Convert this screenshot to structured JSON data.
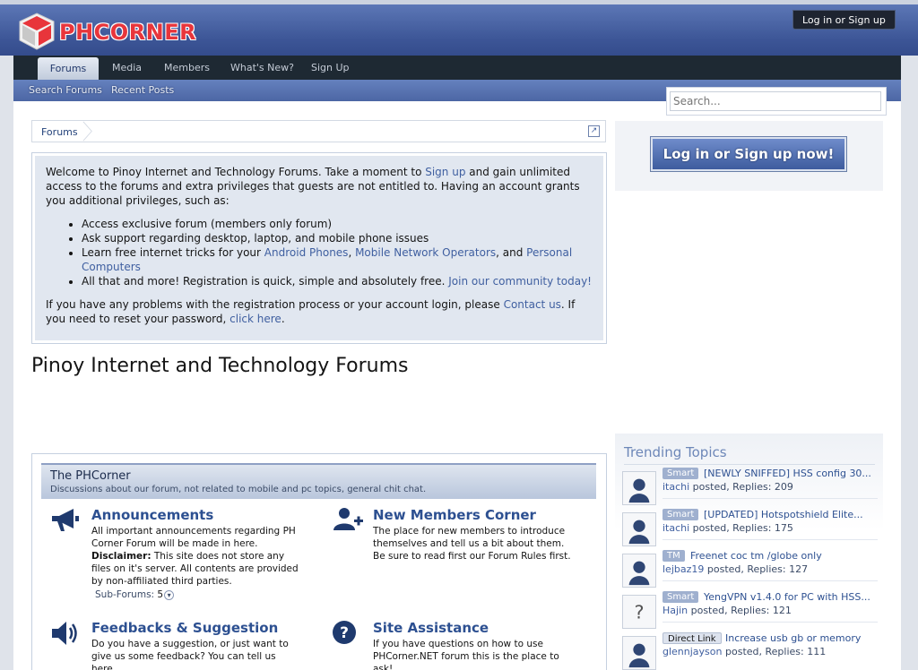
{
  "header": {
    "logo_text": "PHCORNER",
    "login_tab": "Log in or Sign up"
  },
  "nav": {
    "tabs": [
      {
        "label": "Forums"
      },
      {
        "label": "Media"
      },
      {
        "label": "Members"
      },
      {
        "label": "What's New?"
      },
      {
        "label": "Sign Up"
      }
    ],
    "subnav": [
      "Search Forums",
      "Recent Posts"
    ]
  },
  "search": {
    "placeholder": "Search..."
  },
  "breadcrumb": {
    "item": "Forums"
  },
  "notice": {
    "intro_1": "Welcome to Pinoy Internet and Technology Forums. Take a moment to ",
    "signup_link": "Sign up",
    "intro_2": " and gain unlimited access to the forums and extra privileges that guests are not entitled to. Having an account grants you additional privileges, such as:",
    "bullets": {
      "b1": "Access exclusive forum (members only forum)",
      "b2": "Ask support regarding desktop, laptop, and mobile phone issues",
      "b3_text": "Learn free internet tricks for your ",
      "b3_link1": "Android Phones",
      "b3_sep1": ", ",
      "b3_link2": "Mobile Network Operators",
      "b3_sep2": ", and ",
      "b3_link3": "Personal Computers",
      "b4_text": "All that and more! Registration is quick, simple and absolutely free. ",
      "b4_link": "Join our community today!"
    },
    "problem_1": "If you have any problems with the registration process or your account login, please ",
    "contact_link": "Contact us",
    "problem_2": ". If you need to reset your password, ",
    "reset_link": "click here",
    "problem_3": "."
  },
  "forum_title": "Pinoy Internet and Technology Forums",
  "category": {
    "title": "The PHCorner",
    "description": "Discussions about our forum, not related to mobile and pc topics, general chit chat."
  },
  "nodes": {
    "announcements": {
      "title": "Announcements",
      "desc": "All important announcements regarding PH Corner Forum will be made in here.",
      "disclaimer_label": "Disclaimer:",
      "disclaimer": " This site does not store any files on it's server. All contents are provided by non-affiliated third parties.",
      "subforums_label": "Sub-Forums:",
      "subforums_count": "5"
    },
    "new_members": {
      "title": "New Members Corner",
      "desc": "The place for new members to introduce themselves and tell us a bit about them. Be sure to read first our Forum Rules first."
    },
    "feedback": {
      "title": "Feedbacks & Suggestion",
      "desc": "Do you have a suggestion, or just want to give us some feedback? You can tell us here."
    },
    "site_assistance": {
      "title": "Site Assistance",
      "desc": "If you have questions on how to use PHCorner.NET forum this is the place to ask!"
    }
  },
  "sidebar": {
    "login_button": "Log in or Sign up now!",
    "trending_title": "Trending Topics",
    "topics": [
      {
        "prefix": "Smart",
        "title": "[NEWLY SNIFFED] HSS config 30...",
        "user": "itachi",
        "meta": " posted, Replies: 209"
      },
      {
        "prefix": "Smart",
        "title": "[UPDATED] Hotspotshield Elite...",
        "user": "itachi",
        "meta": " posted, Replies: 175"
      },
      {
        "prefix": "TM",
        "title": "Freenet coc tm /globe only",
        "user": "lejbaz19",
        "meta": " posted, Replies: 127"
      },
      {
        "prefix": "Smart",
        "title": "YengVPN v1.4.0 for PC with HSS...",
        "user": "Hajin",
        "meta": " posted, Replies: 121"
      },
      {
        "prefix": "Direct Link",
        "title": "Increase usb gb or memory",
        "user": "glennjayson",
        "meta": " posted, Replies: 111"
      }
    ]
  },
  "colors": {
    "header_blue": "#3c5596",
    "link": "#3f5fa0",
    "logo_red": "#e8353b"
  }
}
